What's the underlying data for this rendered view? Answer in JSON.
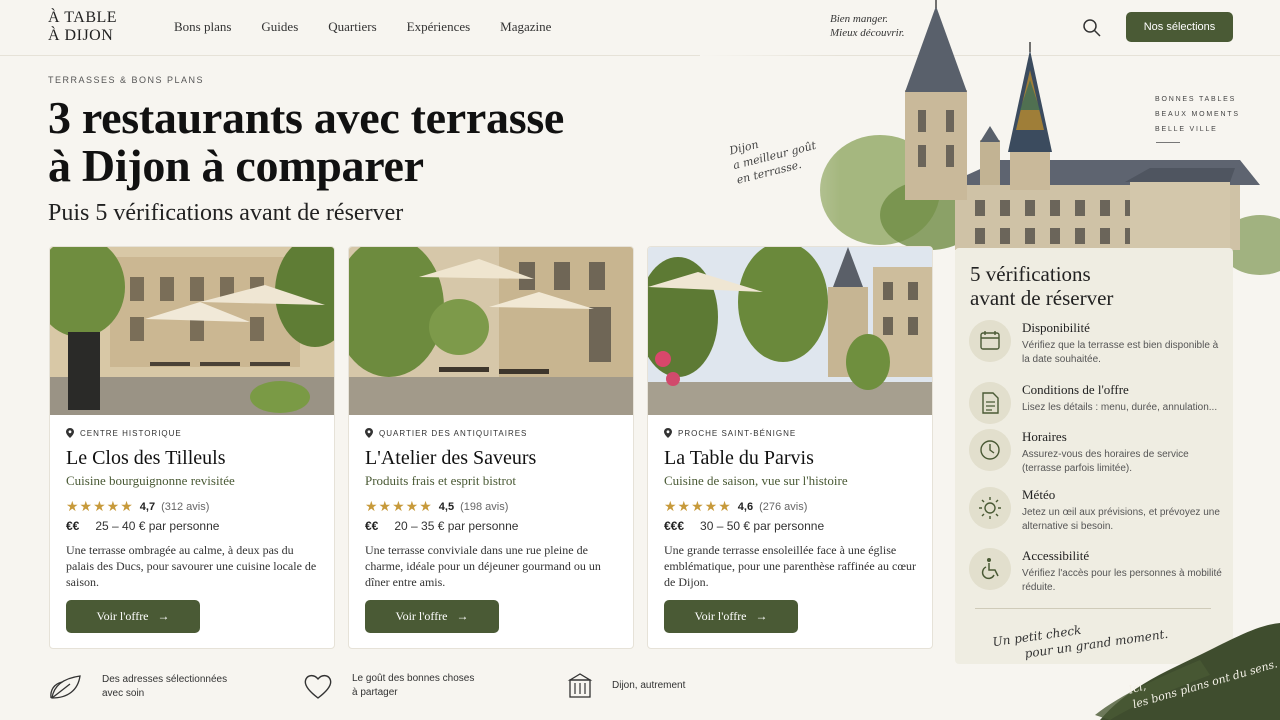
{
  "header": {
    "logo": [
      "À TABLE",
      "À DIJON"
    ],
    "nav": [
      "Bons plans",
      "Guides",
      "Quartiers",
      "Expériences",
      "Magazine"
    ],
    "tagline": [
      "Bien manger.",
      "Mieux découvrir."
    ],
    "cta": "Nos sélections"
  },
  "hero": {
    "eyebrow": "TERRASSES & BONS PLANS",
    "title_lines": [
      "3 restaurants avec terrasse",
      "à Dijon à comparer"
    ],
    "subtitle": "Puis 5 vérifications avant de réserver",
    "script_note": [
      "Dijon",
      "a meilleur goût",
      "en terrasse."
    ],
    "side_words": [
      "BONNES TABLES",
      "BEAUX MOMENTS",
      "BELLE VILLE"
    ]
  },
  "cards": [
    {
      "location": "CENTRE HISTORIQUE",
      "name": "Le Clos des Tilleuls",
      "cuisine": "Cuisine bourguignonne revisitée",
      "stars": "★★★★★",
      "score": "4,7",
      "reviews": "(312 avis)",
      "price_symbol": "€€",
      "price_range": "25 – 40 € par personne",
      "description": "Une terrasse ombragée au calme, à deux pas du palais des Ducs, pour savourer une cuisine locale de saison.",
      "button": "Voir l'offre"
    },
    {
      "location": "QUARTIER DES ANTIQUITAIRES",
      "name": "L'Atelier des Saveurs",
      "cuisine": "Produits frais et esprit bistrot",
      "stars": "★★★★★",
      "score": "4,5",
      "reviews": "(198 avis)",
      "price_symbol": "€€",
      "price_range": "20 – 35 € par personne",
      "description": "Une terrasse conviviale dans une rue pleine de charme, idéale pour un déjeuner gourmand ou un dîner entre amis.",
      "button": "Voir l'offre"
    },
    {
      "location": "PROCHE SAINT-BÉNIGNE",
      "name": "La Table du Parvis",
      "cuisine": "Cuisine de saison, vue sur l'histoire",
      "stars": "★★★★★",
      "score": "4,6",
      "reviews": "(276 avis)",
      "price_symbol": "€€€",
      "price_range": "30 – 50 € par personne",
      "description": "Une grande terrasse ensoleillée face à une église emblématique, pour une parenthèse raffinée au cœur de Dijon.",
      "button": "Voir l'offre"
    }
  ],
  "checklist": {
    "title_lines": [
      "5 vérifications",
      "avant de réserver"
    ],
    "items": [
      {
        "icon": "calendar-icon",
        "title": "Disponibilité",
        "text": "Vérifiez que la terrasse est bien disponible à la date souhaitée."
      },
      {
        "icon": "document-icon",
        "title": "Conditions de l'offre",
        "text": "Lisez les détails : menu, durée, annulation..."
      },
      {
        "icon": "clock-icon",
        "title": "Horaires",
        "text": "Assurez-vous des horaires de service (terrasse parfois limitée)."
      },
      {
        "icon": "sun-icon",
        "title": "Météo",
        "text": "Jetez un œil aux prévisions, et prévoyez une alternative si besoin."
      },
      {
        "icon": "accessibility-icon",
        "title": "Accessibilité",
        "text": "Vérifiez l'accès pour les personnes à mobilité réduite."
      }
    ],
    "note": [
      "Un petit check",
      "pour un grand moment."
    ]
  },
  "features": [
    {
      "icon": "leaf-icon",
      "text": [
        "Des adresses sélectionnées",
        "avec soin"
      ]
    },
    {
      "icon": "heart-icon",
      "text": [
        "Le goût des bonnes choses",
        "à partager"
      ]
    },
    {
      "icon": "monument-icon",
      "text": [
        "Dijon, autrement"
      ]
    }
  ],
  "brush_note": [
    "Ici,",
    "les bons plans ont du sens."
  ],
  "colors": {
    "accent": "#4a5a35",
    "star": "#c79a3b",
    "background": "#f7f5f0",
    "panel": "#efede2"
  }
}
